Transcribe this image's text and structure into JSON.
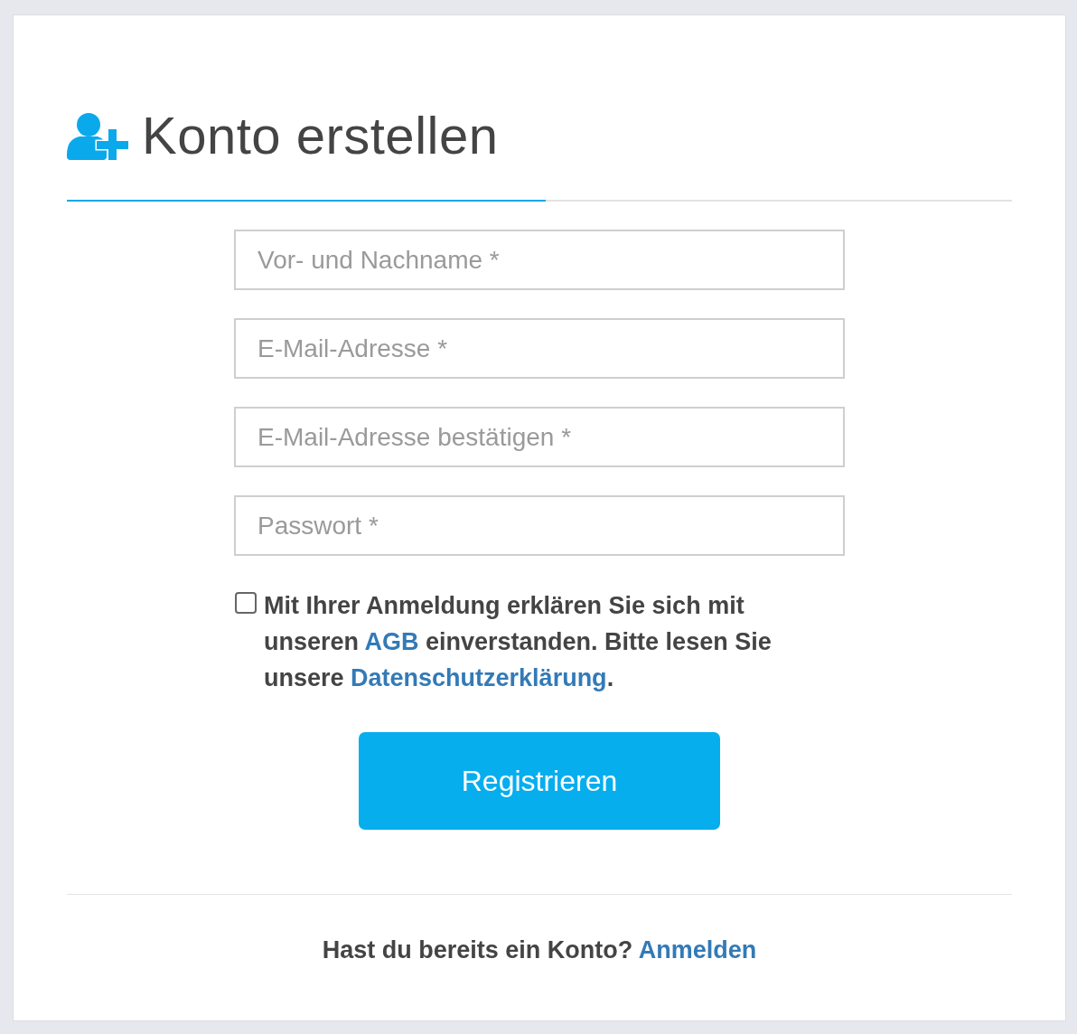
{
  "header": {
    "title": "Konto erstellen"
  },
  "fields": [
    {
      "placeholder": "Vor- und Nachname *"
    },
    {
      "placeholder": "E-Mail-Adresse *"
    },
    {
      "placeholder": "E-Mail-Adresse bestätigen *"
    },
    {
      "placeholder": "Passwort *"
    }
  ],
  "consent": {
    "checked": false,
    "segments": [
      {
        "kind": "text",
        "text": "Mit Ihrer Anmeldung erklären Sie sich mit unseren "
      },
      {
        "kind": "link",
        "text": "AGB"
      },
      {
        "kind": "text",
        "text": " einverstanden. Bitte lesen Sie unsere "
      },
      {
        "kind": "link",
        "text": "Datenschutzerklärung"
      },
      {
        "kind": "text",
        "text": "."
      }
    ]
  },
  "submit_button": {
    "label": "Registrieren"
  },
  "footer": {
    "segments": [
      {
        "kind": "text",
        "text": "Hast du bereits ein Konto? "
      },
      {
        "kind": "link",
        "text": "Anmelden"
      }
    ]
  }
}
